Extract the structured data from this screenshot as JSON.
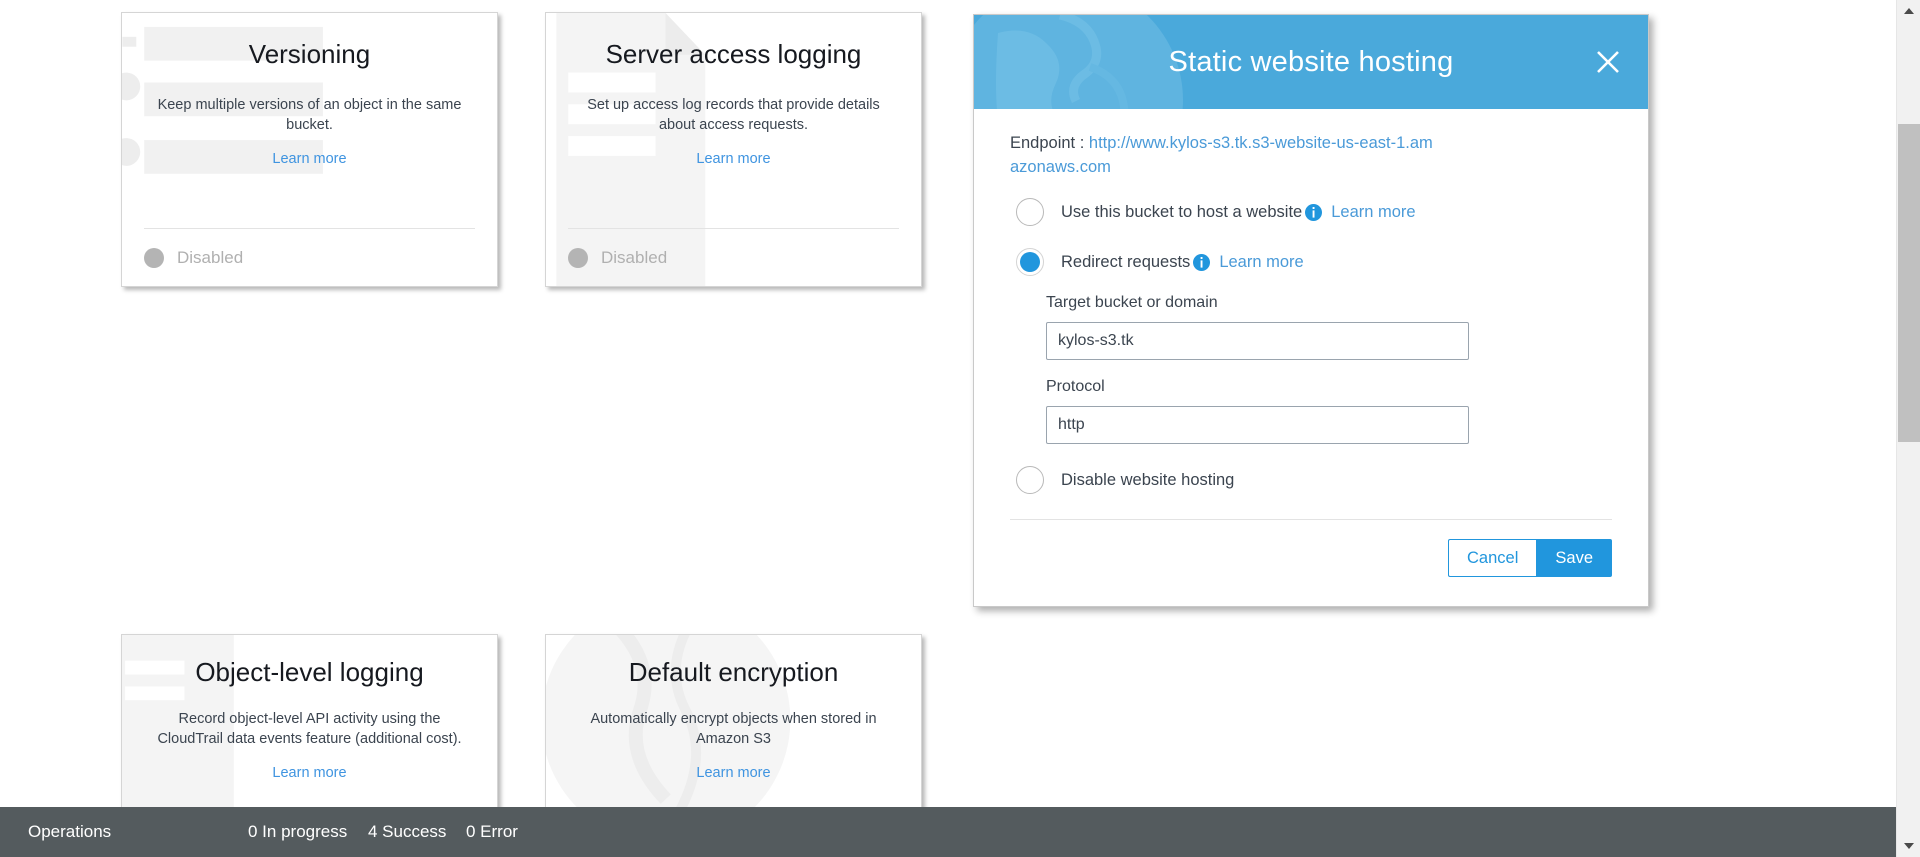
{
  "cards": [
    {
      "id": "versioning",
      "title": "Versioning",
      "description": "Keep multiple versions of an object in the same bucket.",
      "link": "Learn more",
      "status": "Disabled",
      "status_color": "#b4b4b4"
    },
    {
      "id": "server-access-logging",
      "title": "Server access logging",
      "description": "Set up access log records that provide details about access requests.",
      "link": "Learn more",
      "status": "Disabled",
      "status_color": "#b4b4b4"
    },
    {
      "id": "object-level-logging",
      "title": "Object-level logging",
      "description": "Record object-level API activity using the CloudTrail data events feature (additional cost).",
      "link": "Learn more"
    },
    {
      "id": "default-encryption",
      "title": "Default encryption",
      "description": "Automatically encrypt objects when stored in Amazon S3",
      "link": "Learn more"
    }
  ],
  "modal": {
    "title": "Static website hosting",
    "close_icon": "close-icon",
    "header_color": "#4aa9db",
    "endpoint_label": "Endpoint :",
    "endpoint_url": "http://www.kylos-s3.tk.s3-website-us-east-1.amazonaws.com",
    "options": [
      {
        "id": "use-bucket-host-website",
        "label": "Use this bucket to host a website",
        "selected": false,
        "info_icon": "info-icon",
        "learn_more": "Learn more"
      },
      {
        "id": "redirect-requests",
        "label": "Redirect requests",
        "selected": true,
        "info_icon": "info-icon",
        "learn_more": "Learn more"
      },
      {
        "id": "disable-website-hosting",
        "label": "Disable website hosting",
        "selected": false
      }
    ],
    "fields": [
      {
        "id": "target-bucket-or-domain",
        "label": "Target bucket or domain",
        "value": "kylos-s3.tk",
        "placeholder": ""
      },
      {
        "id": "protocol",
        "label": "Protocol",
        "value": "http",
        "placeholder": ""
      }
    ],
    "cancel_label": "Cancel",
    "save_label": "Save",
    "accent_color": "#2196dd"
  },
  "statusbar": {
    "operations_label": "Operations",
    "in_progress": "0 In progress",
    "success": "4 Success",
    "error": "0 Error",
    "background": "#545b5e"
  },
  "scrollbar": {
    "up_arrow": "chevron-up-icon",
    "down_arrow": "chevron-down-icon"
  }
}
